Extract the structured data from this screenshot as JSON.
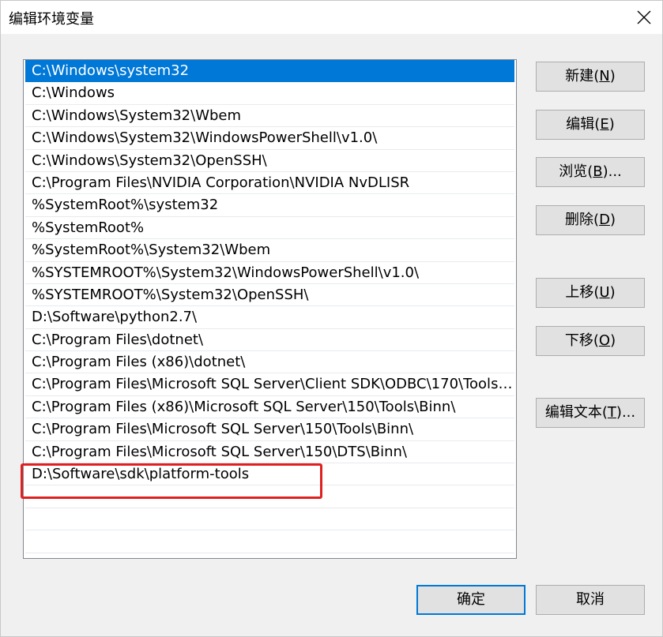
{
  "window": {
    "title": "编辑环境变量"
  },
  "paths": [
    "C:\\Windows\\system32",
    "C:\\Windows",
    "C:\\Windows\\System32\\Wbem",
    "C:\\Windows\\System32\\WindowsPowerShell\\v1.0\\",
    "C:\\Windows\\System32\\OpenSSH\\",
    "C:\\Program Files\\NVIDIA Corporation\\NVIDIA NvDLISR",
    "%SystemRoot%\\system32",
    "%SystemRoot%",
    "%SystemRoot%\\System32\\Wbem",
    "%SYSTEMROOT%\\System32\\WindowsPowerShell\\v1.0\\",
    "%SYSTEMROOT%\\System32\\OpenSSH\\",
    "D:\\Software\\python2.7\\",
    "C:\\Program Files\\dotnet\\",
    "C:\\Program Files (x86)\\dotnet\\",
    "C:\\Program Files\\Microsoft SQL Server\\Client SDK\\ODBC\\170\\Tools\\...",
    "C:\\Program Files (x86)\\Microsoft SQL Server\\150\\Tools\\Binn\\",
    "C:\\Program Files\\Microsoft SQL Server\\150\\Tools\\Binn\\",
    "C:\\Program Files\\Microsoft SQL Server\\150\\DTS\\Binn\\",
    "D:\\Software\\sdk\\platform-tools"
  ],
  "buttons": {
    "new": {
      "text": "新建(",
      "key": "N",
      "end": ")"
    },
    "edit": {
      "text": "编辑(",
      "key": "E",
      "end": ")"
    },
    "browse": {
      "text": "浏览(",
      "key": "B",
      "end": ")..."
    },
    "delete": {
      "text": "删除(",
      "key": "D",
      "end": ")"
    },
    "move_up": {
      "text": "上移(",
      "key": "U",
      "end": ")"
    },
    "move_down": {
      "text": "下移(",
      "key": "O",
      "end": ")"
    },
    "edit_text": {
      "text": "编辑文本(",
      "key": "T",
      "end": ")..."
    },
    "ok": "确定",
    "cancel": "取消"
  },
  "colors": {
    "selection": "#0078d7",
    "highlight_box": "#e02020"
  }
}
